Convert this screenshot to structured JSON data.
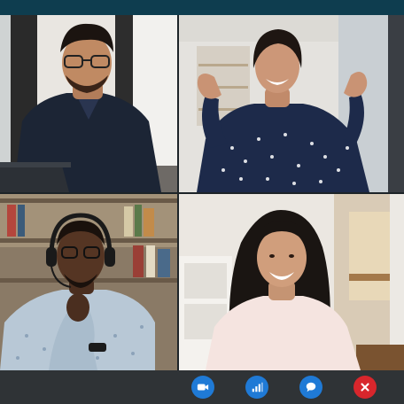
{
  "app": {
    "colors": {
      "top_bar": "#0e3d4f",
      "control_bar": "#2f3336",
      "control_blue": "#1f7ad6",
      "end_call_red": "#d8262c"
    }
  },
  "participants": [
    {
      "tile": "top-left",
      "description_icon": "participant-video"
    },
    {
      "tile": "top-right",
      "description_icon": "participant-video"
    },
    {
      "tile": "bottom-left",
      "description_icon": "participant-video"
    },
    {
      "tile": "bottom-right",
      "description_icon": "participant-video"
    }
  ],
  "controls": [
    {
      "icon": "video-camera-icon",
      "color": "#1f7ad6"
    },
    {
      "icon": "signal-bars-icon",
      "color": "#1f7ad6"
    },
    {
      "icon": "chat-bubble-icon",
      "color": "#1f7ad6"
    },
    {
      "icon": "end-call-close-icon",
      "color": "#d8262c"
    }
  ]
}
